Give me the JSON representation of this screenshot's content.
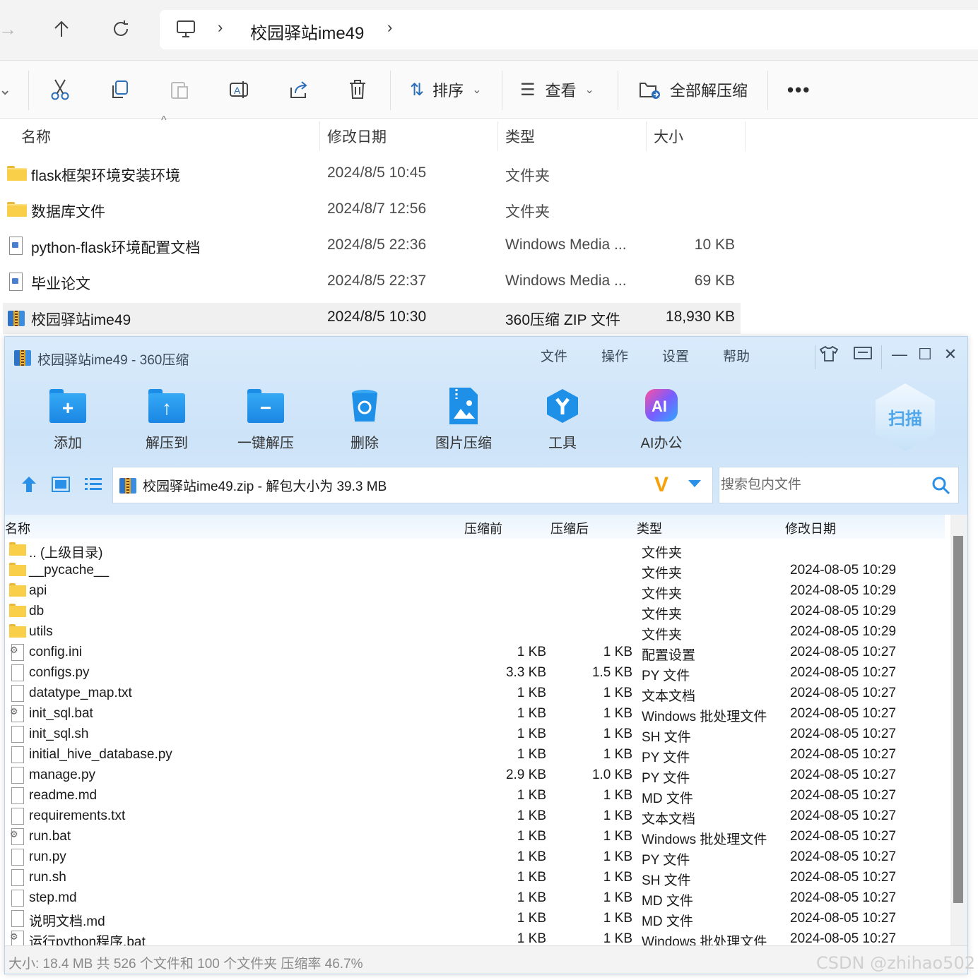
{
  "explorer": {
    "breadcrumb": {
      "current": "校园驿站ime49"
    },
    "toolbar": {
      "sort_label": "排序",
      "view_label": "查看",
      "extract_all_label": "全部解压缩"
    },
    "columns": {
      "name": "名称",
      "modified": "修改日期",
      "type": "类型",
      "size": "大小"
    },
    "rows": [
      {
        "name": "flask框架环境安装环境",
        "modified": "2024/8/5 10:45",
        "type": "文件夹",
        "size": ""
      },
      {
        "name": "数据库文件",
        "modified": "2024/8/7 12:56",
        "type": "文件夹",
        "size": ""
      },
      {
        "name": "python-flask环境配置文档",
        "modified": "2024/8/5 22:36",
        "type": "Windows Media ...",
        "size": "10 KB"
      },
      {
        "name": "毕业论文",
        "modified": "2024/8/5 22:37",
        "type": "Windows Media ...",
        "size": "69 KB"
      },
      {
        "name": "校园驿站ime49",
        "modified": "2024/8/5 10:30",
        "type": "360压缩 ZIP 文件",
        "size": "18,930 KB"
      }
    ]
  },
  "zip": {
    "title": "校园驿站ime49 - 360压缩",
    "menu": [
      "文件",
      "操作",
      "设置",
      "帮助"
    ],
    "buttons": {
      "add": "添加",
      "extract_to": "解压到",
      "one_click_extract": "一键解压",
      "delete": "删除",
      "image_compress": "图片压缩",
      "tools": "工具",
      "ai_office": "AI办公",
      "scan": "扫描"
    },
    "path_text": "校园驿站ime49.zip - 解包大小为 39.3 MB",
    "search_placeholder": "搜索包内文件",
    "columns": {
      "name": "名称",
      "before": "压缩前",
      "after": "压缩后",
      "type": "类型",
      "modified": "修改日期"
    },
    "rows": [
      {
        "icon": "folder",
        "name": ".. (上级目录)",
        "before": "",
        "after": "",
        "type": "文件夹",
        "modified": ""
      },
      {
        "icon": "folder",
        "name": "__pycache__",
        "before": "",
        "after": "",
        "type": "文件夹",
        "modified": "2024-08-05 10:29"
      },
      {
        "icon": "folder",
        "name": "api",
        "before": "",
        "after": "",
        "type": "文件夹",
        "modified": "2024-08-05 10:29"
      },
      {
        "icon": "folder",
        "name": "db",
        "before": "",
        "after": "",
        "type": "文件夹",
        "modified": "2024-08-05 10:29"
      },
      {
        "icon": "folder",
        "name": "utils",
        "before": "",
        "after": "",
        "type": "文件夹",
        "modified": "2024-08-05 10:29"
      },
      {
        "icon": "gear",
        "name": "config.ini",
        "before": "1 KB",
        "after": "1 KB",
        "type": "配置设置",
        "modified": "2024-08-05 10:27"
      },
      {
        "icon": "file",
        "name": "configs.py",
        "before": "3.3 KB",
        "after": "1.5 KB",
        "type": "PY 文件",
        "modified": "2024-08-05 10:27"
      },
      {
        "icon": "file",
        "name": "datatype_map.txt",
        "before": "1 KB",
        "after": "1 KB",
        "type": "文本文档",
        "modified": "2024-08-05 10:27"
      },
      {
        "icon": "gear",
        "name": "init_sql.bat",
        "before": "1 KB",
        "after": "1 KB",
        "type": "Windows 批处理文件",
        "modified": "2024-08-05 10:27"
      },
      {
        "icon": "file",
        "name": "init_sql.sh",
        "before": "1 KB",
        "after": "1 KB",
        "type": "SH 文件",
        "modified": "2024-08-05 10:27"
      },
      {
        "icon": "file",
        "name": "initial_hive_database.py",
        "before": "1 KB",
        "after": "1 KB",
        "type": "PY 文件",
        "modified": "2024-08-05 10:27"
      },
      {
        "icon": "file",
        "name": "manage.py",
        "before": "2.9 KB",
        "after": "1.0 KB",
        "type": "PY 文件",
        "modified": "2024-08-05 10:27"
      },
      {
        "icon": "file",
        "name": "readme.md",
        "before": "1 KB",
        "after": "1 KB",
        "type": "MD 文件",
        "modified": "2024-08-05 10:27"
      },
      {
        "icon": "file",
        "name": "requirements.txt",
        "before": "1 KB",
        "after": "1 KB",
        "type": "文本文档",
        "modified": "2024-08-05 10:27"
      },
      {
        "icon": "gear",
        "name": "run.bat",
        "before": "1 KB",
        "after": "1 KB",
        "type": "Windows 批处理文件",
        "modified": "2024-08-05 10:27"
      },
      {
        "icon": "file",
        "name": "run.py",
        "before": "1 KB",
        "after": "1 KB",
        "type": "PY 文件",
        "modified": "2024-08-05 10:27"
      },
      {
        "icon": "file",
        "name": "run.sh",
        "before": "1 KB",
        "after": "1 KB",
        "type": "SH 文件",
        "modified": "2024-08-05 10:27"
      },
      {
        "icon": "file",
        "name": "step.md",
        "before": "1 KB",
        "after": "1 KB",
        "type": "MD 文件",
        "modified": "2024-08-05 10:27"
      },
      {
        "icon": "file",
        "name": "说明文档.md",
        "before": "1 KB",
        "after": "1 KB",
        "type": "MD 文件",
        "modified": "2024-08-05 10:27"
      },
      {
        "icon": "gear",
        "name": "运行python程序.bat",
        "before": "1 KB",
        "after": "1 KB",
        "type": "Windows 批处理文件",
        "modified": "2024-08-05 10:27"
      }
    ],
    "status": "大小: 18.4 MB 共 526 个文件和 100 个文件夹 压缩率 46.7%"
  },
  "watermark": "CSDN @zhihao502",
  "colors": {
    "zip_header": "#d9ebfb",
    "accent_blue": "#1a86e3",
    "selected_row": "#f0f0f0"
  }
}
